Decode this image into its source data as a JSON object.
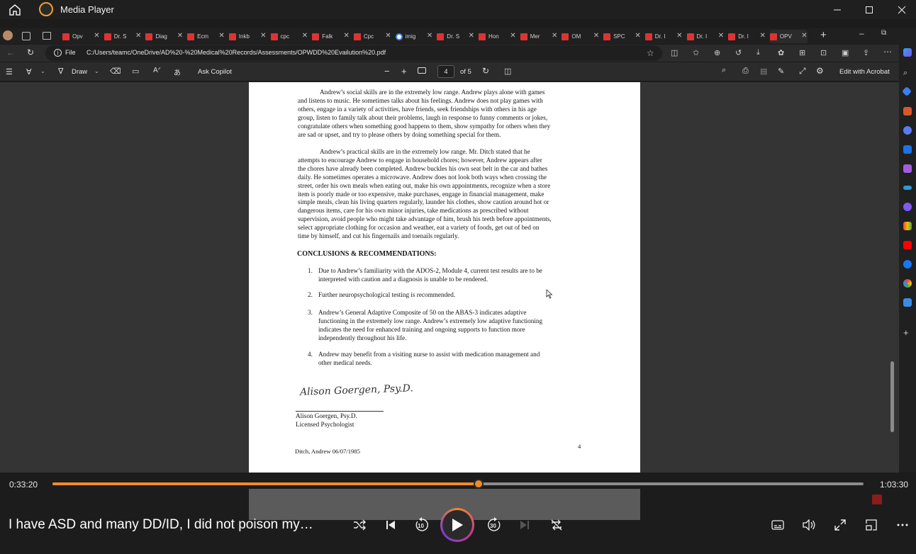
{
  "app": {
    "title": "Media Player"
  },
  "browser": {
    "tabs": [
      {
        "label": "Opv",
        "icon": "pdf-icon"
      },
      {
        "label": "Dr. S",
        "icon": "pdf-icon"
      },
      {
        "label": "Diag",
        "icon": "pdf-icon"
      },
      {
        "label": "Ecm",
        "icon": "pdf-icon"
      },
      {
        "label": "Inkb",
        "icon": "pdf-icon"
      },
      {
        "label": "cpc",
        "icon": "pdf-icon"
      },
      {
        "label": "Falk",
        "icon": "pdf-icon"
      },
      {
        "label": "Cpc",
        "icon": "pdf-icon"
      },
      {
        "label": "imig",
        "icon": "google-icon"
      },
      {
        "label": "Dr. S",
        "icon": "pdf-icon"
      },
      {
        "label": "Hon",
        "icon": "pdf-icon"
      },
      {
        "label": "Mer",
        "icon": "pdf-icon"
      },
      {
        "label": "OM",
        "icon": "pdf-icon"
      },
      {
        "label": "SPC",
        "icon": "pdf-icon"
      },
      {
        "label": "Dr. I",
        "icon": "pdf-icon"
      },
      {
        "label": "Dr. I",
        "icon": "pdf-icon"
      },
      {
        "label": "Dr. I",
        "icon": "pdf-icon"
      },
      {
        "label": "OPV",
        "icon": "pdf-icon",
        "active": true
      }
    ],
    "address": {
      "scheme_label": "File",
      "url": "C:/Users/teamc/OneDrive/AD%20-%20Medical%20Records/Assessments/OPWDD%20Evailution%20.pdf"
    }
  },
  "pdf_toolbar": {
    "draw_label": "Draw",
    "ask_copilot_label": "Ask Copilot",
    "page_current": "4",
    "page_total": "of 5",
    "edit_label": "Edit with Acrobat"
  },
  "document": {
    "para_social": [
      "Andrew’s social skills are in the extremely low range. Andrew plays alone with games",
      "and listens to music. He sometimes talks about his feelings. Andrew does not play games with",
      "others, engage in a variety of activities, have friends, seek friendships with others in his age",
      "group, listen to family talk about their problems, laugh in response to funny comments or jokes,",
      "congratulate others when something good happens to them, show sympathy for others when they",
      "are sad or upset, and try to please others by doing something special for them."
    ],
    "para_practical": [
      "Andrew’s practical skills are in the extremely low range. Mr. Ditch stated that he",
      "attempts to encourage Andrew to engage in household chores; however, Andrew appears after",
      "the chores have already been completed. Andrew buckles his own seat belt in the car and bathes",
      "daily. He sometimes operates a microwave. Andrew does not look both ways when crossing the",
      "street, order his own meals when eating out, make his own appointments, recognize when a store",
      "item is poorly made or too expensive, make purchases, engage in financial management, make",
      "simple meals, clean his living quarters regularly, launder his clothes, show caution around hot or",
      "dangerous items, care for his own minor injuries, take medications as prescribed without",
      "supervision, avoid people who might take advantage of him, brush his teeth before appointments,",
      "select appropriate clothing for occasion and weather, eat a variety of foods, get out of bed on",
      "time by himself, and cut his fingernails and toenails regularly."
    ],
    "heading": "CONCLUSIONS & RECOMMENDATIONS:",
    "recommendations": [
      {
        "num": "1.",
        "lines": [
          "Due to Andrew’s familiarity with the ADOS-2, Module 4, current test results are to be",
          "interpreted with caution and a diagnosis is unable to be rendered."
        ]
      },
      {
        "num": "2.",
        "lines": [
          "Further neuropsychological testing is recommended."
        ]
      },
      {
        "num": "3.",
        "lines": [
          "Andrew’s General Adaptive Composite of 50 on the ABAS-3 indicates adaptive",
          "functioning in the extremely low range. Andrew’s extremely low adaptive functioning",
          "indicates the need for enhanced training and ongoing supports to function more",
          "independently throughout his life."
        ]
      },
      {
        "num": "4.",
        "lines": [
          "Andrew may benefit from a visiting nurse to assist with medication management and",
          "other medical needs."
        ]
      }
    ],
    "signature_script": "Alison Goergen, Psy.D.",
    "signer_name": "Alison Goergen, Psy.D.",
    "signer_title": "Licensed Psychologist",
    "footer_left": "Ditch, Andrew 06/07/1985",
    "footer_page": "4"
  },
  "player": {
    "current_time": "0:33:20",
    "total_time": "1:03:30",
    "progress_fraction": 0.525,
    "video_title": "I have ASD and many DD/ID, I did not poison my…",
    "skip_back_label": "10",
    "skip_forward_label": "30",
    "accent_color": "#f08a2c"
  }
}
